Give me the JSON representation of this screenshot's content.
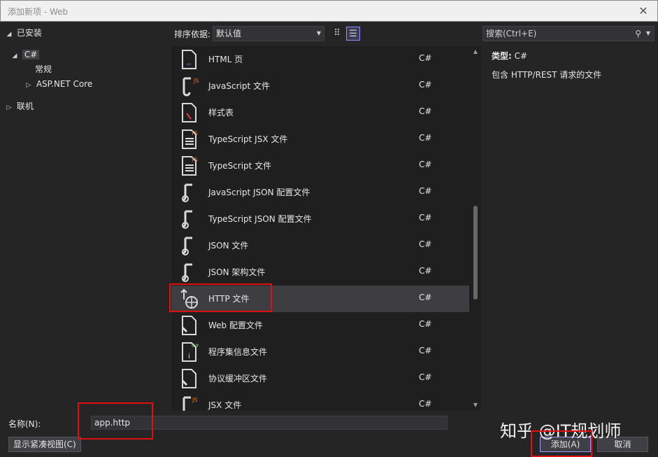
{
  "window": {
    "title": "添加新项 - Web",
    "close_icon": "close-icon"
  },
  "tree": {
    "installed": "已安装",
    "csharp": "C#",
    "common": "常规",
    "aspnet": "ASP.NET Core",
    "online": "联机"
  },
  "toolbar": {
    "sort_label": "排序依据:",
    "sort_value": "默认值",
    "search_placeholder": "搜索(Ctrl+E)"
  },
  "items": [
    {
      "name": "HTML 页",
      "lang": "C#",
      "icon": "html-page-icon"
    },
    {
      "name": "JavaScript 文件",
      "lang": "C#",
      "icon": "javascript-file-icon"
    },
    {
      "name": "样式表",
      "lang": "C#",
      "icon": "stylesheet-icon"
    },
    {
      "name": "TypeScript JSX 文件",
      "lang": "C#",
      "icon": "typescript-jsx-icon"
    },
    {
      "name": "TypeScript 文件",
      "lang": "C#",
      "icon": "typescript-file-icon"
    },
    {
      "name": "JavaScript JSON 配置文件",
      "lang": "C#",
      "icon": "json-config-icon"
    },
    {
      "name": "TypeScript JSON 配置文件",
      "lang": "C#",
      "icon": "json-config-icon"
    },
    {
      "name": "JSON 文件",
      "lang": "C#",
      "icon": "json-file-icon"
    },
    {
      "name": "JSON 架构文件",
      "lang": "C#",
      "icon": "json-schema-icon"
    },
    {
      "name": "HTTP 文件",
      "lang": "C#",
      "icon": "http-file-icon",
      "selected": true
    },
    {
      "name": "Web 配置文件",
      "lang": "C#",
      "icon": "web-config-icon"
    },
    {
      "name": "程序集信息文件",
      "lang": "C#",
      "icon": "assembly-info-icon"
    },
    {
      "name": "协议缓冲区文件",
      "lang": "C#",
      "icon": "protobuf-file-icon"
    },
    {
      "name": "JSX 文件",
      "lang": "C#",
      "icon": "jsx-file-icon"
    }
  ],
  "details": {
    "type_label": "类型:",
    "type_value": "C#",
    "description": "包含 HTTP/REST 请求的文件"
  },
  "bottom": {
    "name_label": "名称(N):",
    "name_value": "app.http",
    "compact_button": "显示紧凑视图(C)",
    "add_button": "添加(A)",
    "cancel_button": "取消"
  },
  "watermark": "知乎 @IT规划师",
  "colors": {
    "highlight": "#e01010",
    "background": "#252526",
    "list_bg": "#1f1f1f"
  }
}
